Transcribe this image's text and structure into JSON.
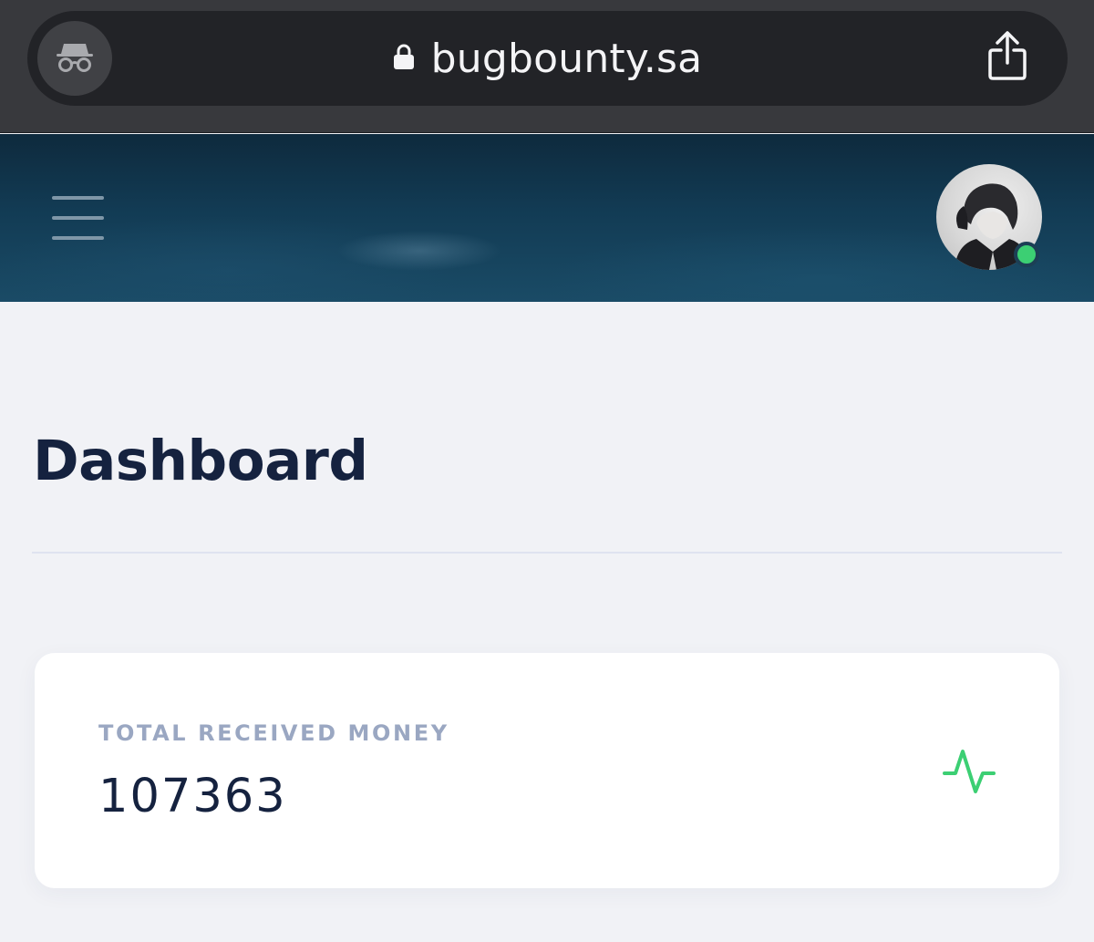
{
  "browser": {
    "url": "bugbounty.sa",
    "icons": {
      "incognito": "incognito-icon",
      "lock": "lock-icon",
      "share": "share-icon"
    }
  },
  "header": {
    "menu_icon": "hamburger-menu-icon",
    "avatar_status": "online",
    "status_color": "#3ccf73"
  },
  "page": {
    "title": "Dashboard"
  },
  "stat_card": {
    "label": "TOTAL RECEIVED MONEY",
    "value": "107363",
    "icon": "activity-icon",
    "icon_color": "#3ccf73"
  }
}
